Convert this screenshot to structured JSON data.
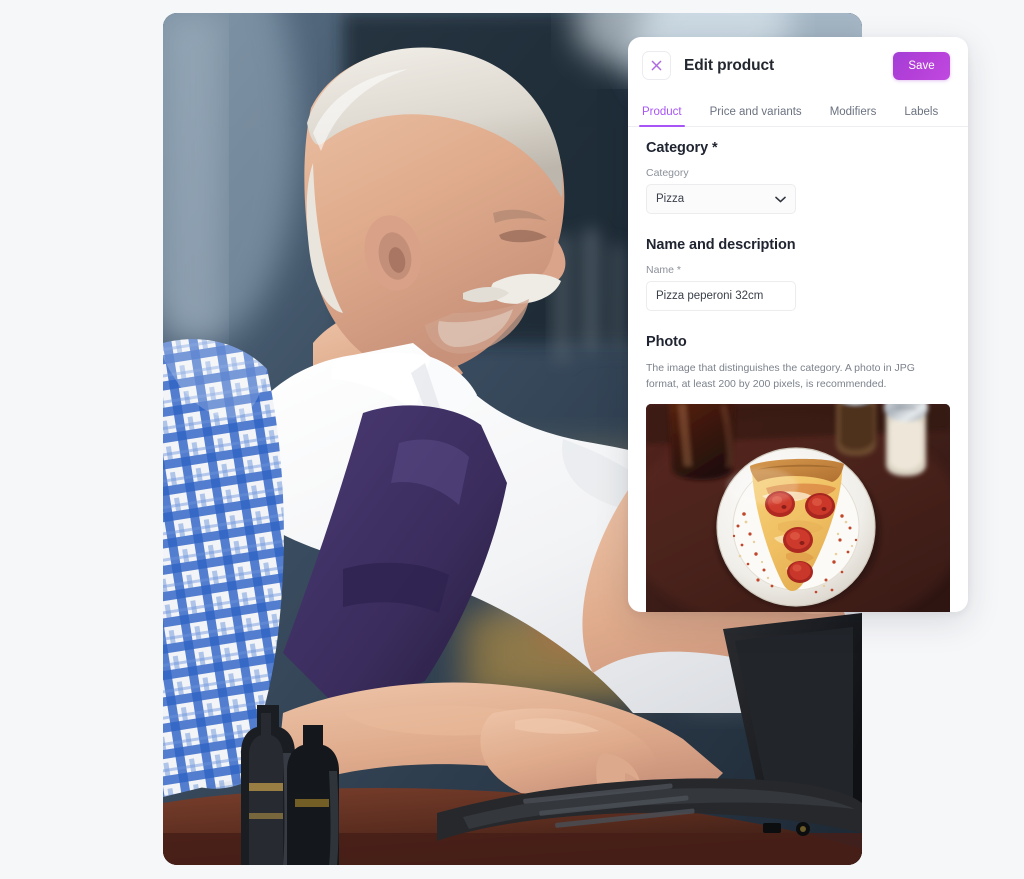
{
  "window": {
    "background_color": "#f6f7f9"
  },
  "background_photo": {
    "alt": "Older man in white polo shirt and purple apron with blue checkered towel, typing on a laptop at a restaurant counter",
    "name": "background-photo"
  },
  "card": {
    "header": {
      "close_icon": "close-icon",
      "close_label": "×",
      "title": "Edit product",
      "save_label": "Save",
      "accent_color": "#a855f7",
      "save_gradient_from": "#a23fd6",
      "save_gradient_to": "#c04ae0"
    },
    "tabs": [
      {
        "label": "Product",
        "active": true
      },
      {
        "label": "Price and variants",
        "active": false
      },
      {
        "label": "Modifiers",
        "active": false
      },
      {
        "label": "Labels",
        "active": false
      }
    ],
    "sections": {
      "category": {
        "heading": "Category *",
        "field_label": "Category",
        "selected_value": "Pizza",
        "chevron_icon": "chevron-down-icon"
      },
      "name_and_description": {
        "heading": "Name and description",
        "field_label": "Name *",
        "value": "Pizza peperoni 32cm",
        "placeholder": "Pizza peperoni 32cm"
      },
      "photo": {
        "heading": "Photo",
        "help_text": "The image that distinguishes the category. A photo in JPG format, at least 200 by 200 pixels, is recommended.",
        "image_alt": "Slice of pepperoni pizza on a white plate on a dark wooden table, with a cola glass and shakers"
      }
    }
  }
}
